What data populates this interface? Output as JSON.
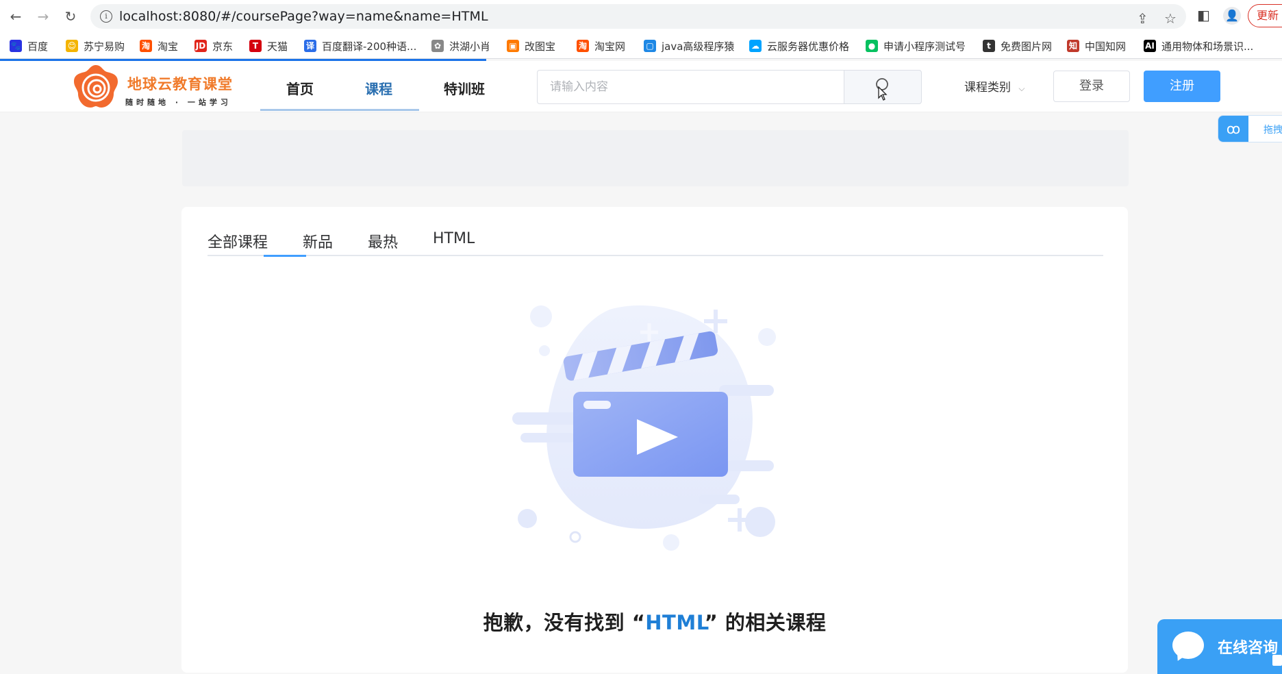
{
  "browser": {
    "url": "localhost:8080/#/coursePage?way=name&name=HTML",
    "update_label": "更新"
  },
  "bookmarks": [
    {
      "label": "百度",
      "color": "#2932e1",
      "glyph": "🐾"
    },
    {
      "label": "苏宁易购",
      "color": "#f4b400",
      "glyph": "😊"
    },
    {
      "label": "淘宝",
      "color": "#ff5000",
      "glyph": "淘"
    },
    {
      "label": "京东",
      "color": "#e1251b",
      "glyph": "JD"
    },
    {
      "label": "天猫",
      "color": "#d4000e",
      "glyph": "T"
    },
    {
      "label": "百度翻译-200种语...",
      "color": "#2b6de8",
      "glyph": "译"
    },
    {
      "label": "洪湖小肖",
      "color": "#888888",
      "glyph": "✿"
    },
    {
      "label": "改图宝",
      "color": "#ff7a00",
      "glyph": "▣"
    },
    {
      "label": "淘宝网",
      "color": "#ff5000",
      "glyph": "淘"
    },
    {
      "label": "java高级程序猿",
      "color": "#1e88e5",
      "glyph": "▢"
    },
    {
      "label": "云服务器优惠价格",
      "color": "#00a3ff",
      "glyph": "☁"
    },
    {
      "label": "申请小程序测试号",
      "color": "#07c160",
      "glyph": "●"
    },
    {
      "label": "免费图片网",
      "color": "#333333",
      "glyph": "t"
    },
    {
      "label": "中国知网",
      "color": "#c0392b",
      "glyph": "知"
    },
    {
      "label": "通用物体和场景识...",
      "color": "#000000",
      "glyph": "AI"
    }
  ],
  "site": {
    "logo_title": "地球云教育课堂",
    "logo_subtitle": "随时随地 · 一站学习",
    "nav": [
      {
        "label": "首页",
        "active": false
      },
      {
        "label": "课程",
        "active": true
      },
      {
        "label": "特训班",
        "active": false
      }
    ],
    "search_placeholder": "请输入内容",
    "category_label": "课程类别",
    "login_label": "登录",
    "register_label": "注册",
    "float_widget_text": "拖拽",
    "accent_color": "#409eff",
    "brand_color": "#f07a2a"
  },
  "course_tabs": [
    {
      "label": "全部课程",
      "active": true
    },
    {
      "label": "新品",
      "active": false
    },
    {
      "label": "最热",
      "active": false
    },
    {
      "label": "HTML",
      "active": false
    }
  ],
  "empty_state": {
    "prefix": "抱歉，没有找到 “",
    "keyword": "HTML",
    "suffix": "” 的相关课程"
  },
  "chat": {
    "label": "在线咨询"
  }
}
